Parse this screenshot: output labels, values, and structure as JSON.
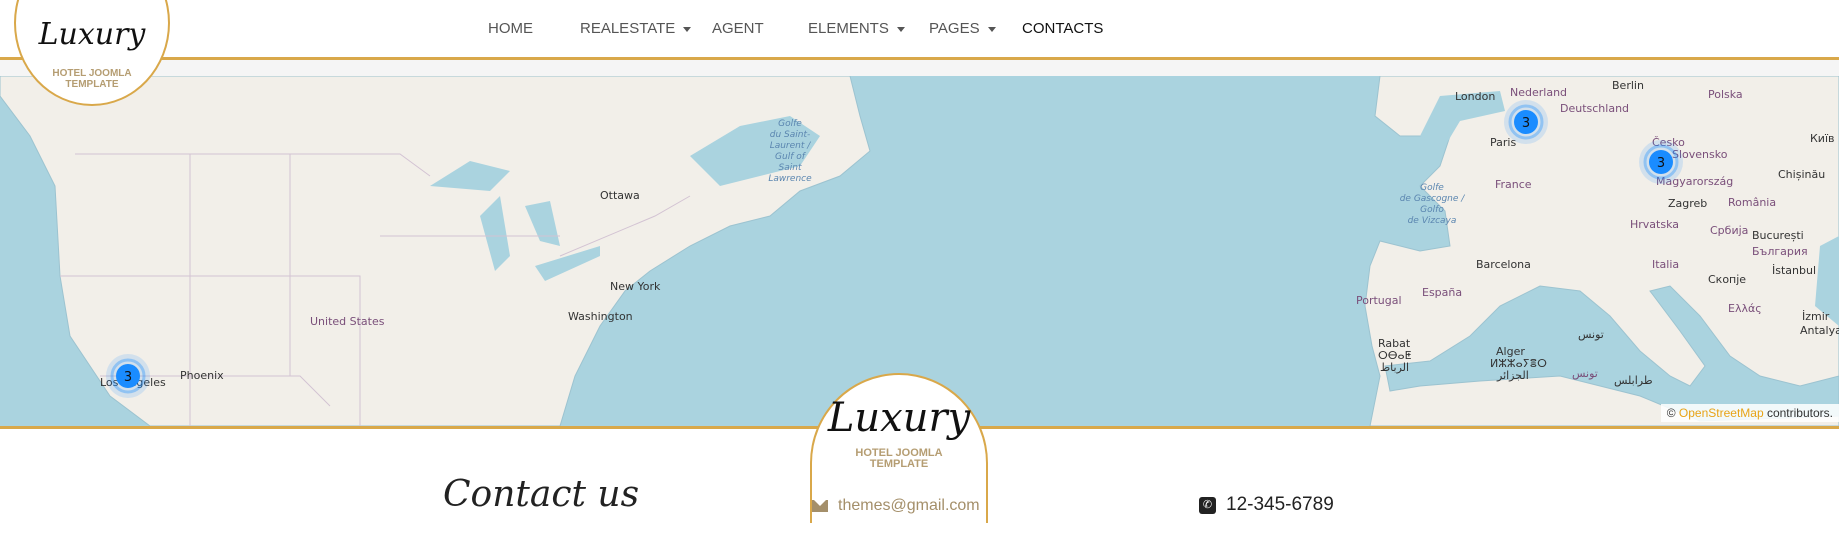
{
  "logo": {
    "word": "Luxury",
    "sub1": "HOTEL JOOMLA",
    "sub2": "TEMPLATE"
  },
  "nav": [
    {
      "label": "HOME",
      "dropdown": false
    },
    {
      "label": "REALESTATE",
      "dropdown": true
    },
    {
      "label": "AGENT",
      "dropdown": false
    },
    {
      "label": "ELEMENTS",
      "dropdown": true
    },
    {
      "label": "PAGES",
      "dropdown": true
    },
    {
      "label": "CONTACTS",
      "dropdown": false,
      "active": true
    }
  ],
  "map": {
    "labels": {
      "ottawa": "Ottawa",
      "new_york": "New York",
      "washington": "Washington",
      "united_states": "United States",
      "phoenix": "Phoenix",
      "los_angeles": "Los Angeles",
      "golfe1": "Golfe",
      "golfe2": "du Saint-",
      "golfe3": "Laurent /",
      "golfe4": "Gulf of",
      "golfe5": "Saint",
      "golfe6": "Lawrence",
      "london": "London",
      "nederland": "Nederland",
      "deutschland": "Deutschland",
      "berlin": "Berlin",
      "polska": "Polska",
      "paris": "Paris",
      "france": "France",
      "cesko": "Česko",
      "slovensko": "Slovensko",
      "magyar": "Magyarország",
      "zagreb": "Zagreb",
      "romania": "România",
      "chisinau": "Chișinău",
      "kyiv": "Київ",
      "hrvatska": "Hrvatska",
      "srbija": "Србија",
      "bucuresti": "București",
      "bulgaria": "България",
      "barcelona": "Barcelona",
      "italia": "Italia",
      "istanbul": "İstanbul",
      "skopje": "Скопје",
      "espana": "España",
      "portugal": "Portugal",
      "ellas": "Ελλάς",
      "izmir": "İzmir",
      "antalya": "Antalya",
      "rabat": "Rabat",
      "rabat2": "ⵔⴱⴰⵟ",
      "rabat3": "الرباط",
      "alger": "Alger",
      "alger2": "ⵍⵣⵣⴰⵢⴻⵔ",
      "alger3": "الجزائر",
      "tunis": "تونس",
      "tunisia": "تونس",
      "tripoli": "طرابلس",
      "gasc1": "Golfe",
      "gasc2": "de Gascogne /",
      "gasc3": "Golfo",
      "gasc4": "de Vizcaya"
    },
    "clusters": [
      {
        "name": "Los Angeles",
        "count": "3"
      },
      {
        "name": "Paris",
        "count": "3"
      },
      {
        "name": "Budapest",
        "count": "3"
      }
    ],
    "colors": {
      "sea": "#aad3df",
      "land": "#f2efe9",
      "border": "#c9b3c9",
      "cluster": "#1a8cff"
    },
    "attribution_prefix": "© ",
    "attribution_link": "OpenStreetMap",
    "attribution_suffix": " contributors."
  },
  "contact": {
    "title": "Contact us",
    "email": "themes@gmail.com",
    "phone": "12-345-6789",
    "email_icon": "envelope-icon",
    "phone_icon": "phone-icon"
  }
}
